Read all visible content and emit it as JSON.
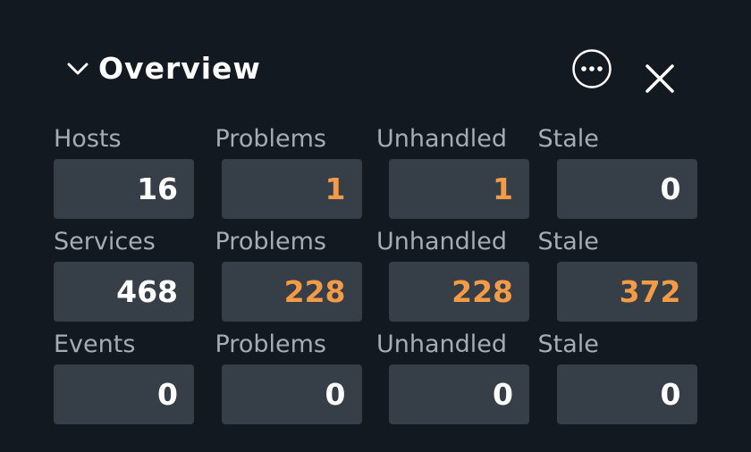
{
  "header": {
    "title": "Overview",
    "collapse_icon": "chevron-down-icon",
    "more_icon": "more-horizontal-circle-icon",
    "close_icon": "close-icon"
  },
  "colors": {
    "background": "#131920",
    "cell_background": "#363e47",
    "label": "#a5acb3",
    "value_normal": "#ffffff",
    "value_warning": "#f59b46"
  },
  "rows": [
    {
      "labels": [
        "Hosts",
        "Problems",
        "Unhandled",
        "Stale"
      ],
      "values": [
        "16",
        "1",
        "1",
        "0"
      ],
      "states": [
        "normal",
        "warn",
        "warn",
        "normal"
      ]
    },
    {
      "labels": [
        "Services",
        "Problems",
        "Unhandled",
        "Stale"
      ],
      "values": [
        "468",
        "228",
        "228",
        "372"
      ],
      "states": [
        "normal",
        "warn",
        "warn",
        "warn"
      ]
    },
    {
      "labels": [
        "Events",
        "Problems",
        "Unhandled",
        "Stale"
      ],
      "values": [
        "0",
        "0",
        "0",
        "0"
      ],
      "states": [
        "normal",
        "normal",
        "normal",
        "normal"
      ]
    }
  ]
}
